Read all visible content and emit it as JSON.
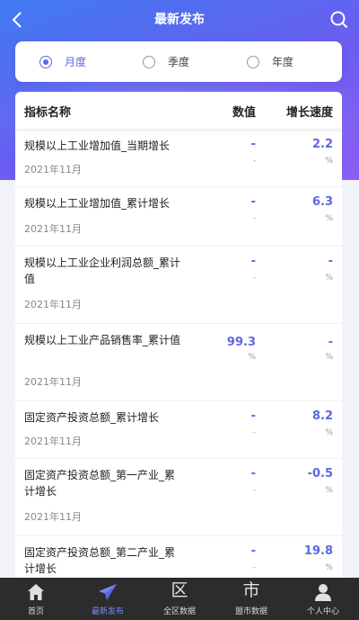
{
  "header": {
    "title": "最新发布"
  },
  "period": {
    "options": [
      {
        "label": "月度",
        "selected": true
      },
      {
        "label": "季度",
        "selected": false
      },
      {
        "label": "年度",
        "selected": false
      }
    ]
  },
  "table": {
    "columns": {
      "name": "指标名称",
      "value": "数值",
      "growth": "增长速度"
    },
    "rows": [
      {
        "name": "规模以上工业增加值_当期增长",
        "date": "2021年11月",
        "value": "-",
        "value_unit": "-",
        "growth": "2.2",
        "growth_unit": "%"
      },
      {
        "name": "规模以上工业增加值_累计增长",
        "date": "2021年11月",
        "value": "-",
        "value_unit": "-",
        "growth": "6.3",
        "growth_unit": "%"
      },
      {
        "name": "规模以上工业企业利润总额_累计值",
        "date": "2021年11月",
        "value": "-",
        "value_unit": "-",
        "growth": "-",
        "growth_unit": "%"
      },
      {
        "name": "规模以上工业产品销售率_累计值",
        "date": "2021年11月",
        "value": "99.3",
        "value_unit": "%",
        "growth": "-",
        "growth_unit": "%"
      },
      {
        "name": "固定资产投资总额_累计增长",
        "date": "2021年11月",
        "value": "-",
        "value_unit": "-",
        "growth": "8.2",
        "growth_unit": "%"
      },
      {
        "name": "固定资产投资总额_第一产业_累计增长",
        "date": "2021年11月",
        "value": "-",
        "value_unit": "-",
        "growth": "-0.5",
        "growth_unit": "%"
      },
      {
        "name": "固定资产投资总额_第二产业_累计增长",
        "date": "",
        "value": "-",
        "value_unit": "-",
        "growth": "19.8",
        "growth_unit": "%"
      }
    ]
  },
  "tabbar": {
    "items": [
      {
        "label": "首页",
        "icon": "home-icon"
      },
      {
        "label": "最新发布",
        "icon": "paper-plane-icon",
        "active": true
      },
      {
        "label": "全区数据",
        "icon": "region-glyph-icon",
        "glyph": "区"
      },
      {
        "label": "盟市数据",
        "icon": "city-glyph-icon",
        "glyph": "市"
      },
      {
        "label": "个人中心",
        "icon": "user-icon"
      }
    ]
  },
  "colors": {
    "accent": "#5b68e0",
    "tabbar_bg": "#2c2c2c"
  }
}
